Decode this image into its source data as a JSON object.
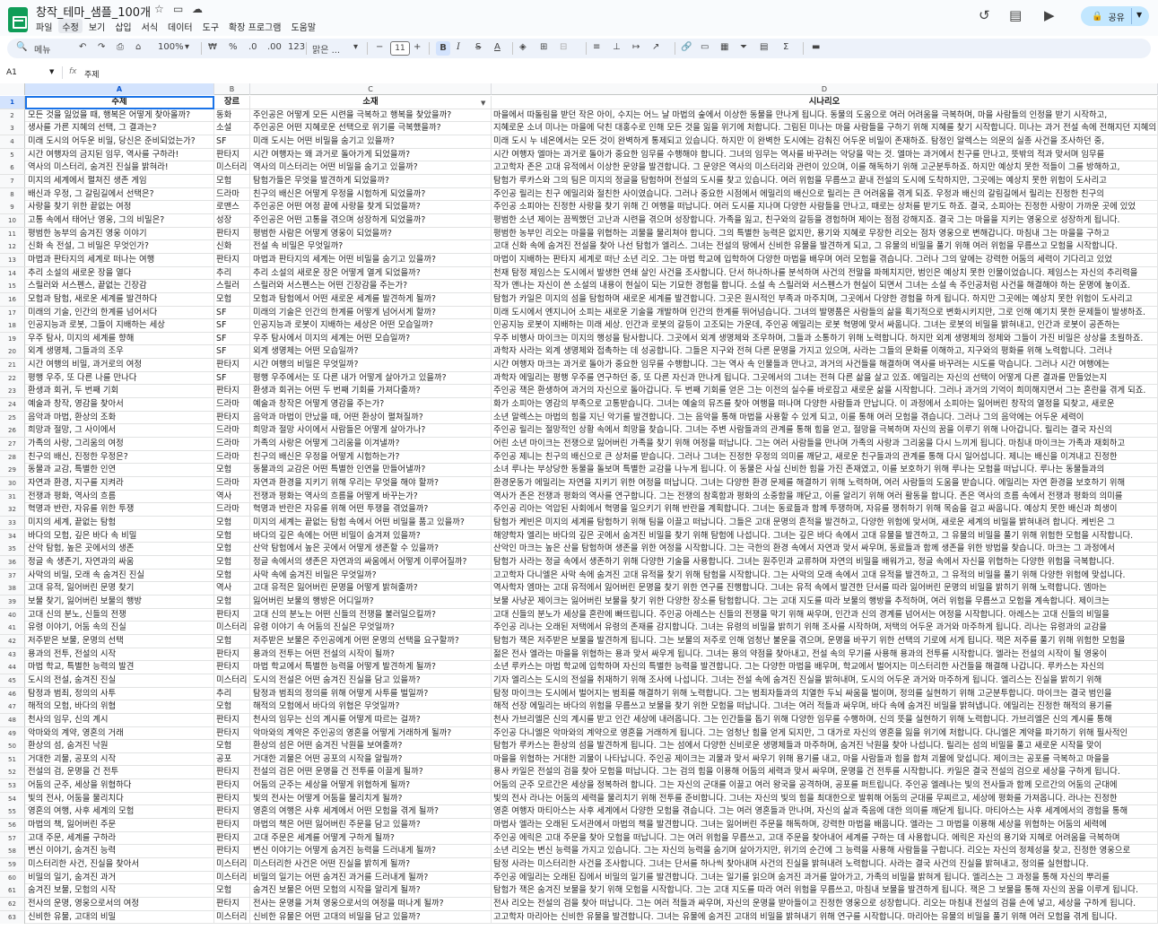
{
  "app": {
    "doc_title": "창작_테마_샘플_100개",
    "menus": [
      "파일",
      "수정",
      "보기",
      "삽입",
      "서식",
      "데이터",
      "도구",
      "확장 프로그램",
      "도움말"
    ],
    "active_menu": "수정",
    "share_label": "공유"
  },
  "toolbar": {
    "search_label": "메뉴",
    "zoom": "100%",
    "currency": "₩",
    "percent": "%",
    "dec_minus": ".0",
    "dec_plus": ".00",
    "num_format": "123",
    "font_name": "맑은 ...",
    "font_size": "11",
    "bold": "B",
    "italic": "I"
  },
  "formula_bar": {
    "cell_ref": "A1",
    "fx": "fx",
    "value": "주제"
  },
  "columns": [
    "A",
    "B",
    "C",
    "D"
  ],
  "header_row": {
    "a": "주제",
    "b": "장르",
    "c": "소재",
    "d": "시나리오"
  },
  "rows": [
    {
      "n": "2",
      "a": "모든 것을 잃었을 때, 행복은 어떻게 찾아올까?",
      "b": "동화",
      "c": "주인공은 어떻게 모든 시련을 극복하고 행복을 찾았을까?",
      "d": "마을에서 따돌림을 받던 작은 아이, 수지는 어느 날 마법의 숲에서 이상한 동물을 만나게 됩니다. 동물의 도움으로 여러 어려움을 극복하며, 마을 사람들의 인정을 받기 시작하고,"
    },
    {
      "n": "3",
      "a": "생사를 가른 지혜의 선택, 그 결과는?",
      "b": "소설",
      "c": "주인공은 어떤 지혜로운 선택으로 위기를 극복했을까?",
      "d": "지혜로운 소녀 미나는 마을에 닥친 대홍수로 인해 모든 것을 잃을 위기에 처합니다. 그림된 미나는 마을 사람들을 구하기 위해 지혜를 찾기 시작합니다. 미나는 과거 전설 속에 전해지던 지혜의 열쇠를"
    },
    {
      "n": "4",
      "a": "미래 도시의 어두운 비밀, 당신은 준비되었는가?",
      "b": "SF",
      "c": "미래 도시는 어떤 비밀을 숨기고 있을까?",
      "d": "미래 도시 누 네온에서는 모든 것이 완벽하게 통제되고 있습니다. 하지만 이 완벽한 도시에는 감춰진 어두운 비밀이 존재하죠. 탐정인 알렉스는 의문의 실종 사건을 조사하던 중,"
    },
    {
      "n": "5",
      "a": "시간 여행자의 금지된 임무, 역사를 구하라!",
      "b": "판타지",
      "c": "시간 여행자는 왜 과거로 돌아가게 되었을까?",
      "d": "시간 여행자 엘마는 과거로 돌아가 중요한 임무를 수행해야 합니다. 그녀의 임무는 역사를 바꾸려는 악당을 막는 것. 엘마는 과거에서 친구를 만나고, 뜻밖의 적과 맞서며 임무를"
    },
    {
      "n": "6",
      "a": "역사의 미스터리, 숨겨진 진실을 밝혀라!",
      "b": "미스터리",
      "c": "역사의 미스터리는 어떤 비밀을 숨기고 있을까?",
      "d": "고고학자 존은 고대 유적에서 이상한 문양을 발견합니다. 그 문양은 역사의 미스터리와 관련이 있으며, 이를 해독하기 위해 고군분투하죠. 하지만 예상치 못한 적들이 그를 방해하고,"
    },
    {
      "n": "7",
      "a": "미지의 세계에서 펼쳐진 생존 게임",
      "b": "모험",
      "c": "탐험가들은 무엇을 발견하게 되었을까?",
      "d": "탐험가 루카스와 그의 팀은 미지의 정글을 탐험하며 전설의 도시를 찾고 있습니다. 여러 위험을 무릅쓰고 끝내 전설의 도시에 도착하지만, 그곳에는 예상치 못한 위험이 도사리고"
    },
    {
      "n": "8",
      "a": "배신과 우정, 그 갈림길에서 선택은?",
      "b": "드라마",
      "c": "친구의 배신은 어떻게 우정을 시험하게 되었을까?",
      "d": "주인공 릴리는 친구 에밀리와 절친한 사이였습니다. 그러나 중요한 시점에서 에밀리의 배신으로 릴리는 큰 어려움을 겪게 되죠. 우정과 배신의 갈림길에서 릴리는 진정한 친구의"
    },
    {
      "n": "9",
      "a": "사랑을 찾기 위한 끝없는 여정",
      "b": "로맨스",
      "c": "주인공은 어떤 여정 끝에 사랑을 찾게 되었을까?",
      "d": "주인공 소피아는 진정한 사랑을 찾기 위해 긴 여행을 떠납니다. 여러 도시를 지나며 다양한 사람들을 만나고, 때로는 상처를 받기도 하죠. 결국, 소피아는 진정한 사랑이 가까운 곳에 있었"
    },
    {
      "n": "10",
      "a": "고통 속에서 태어난 영웅, 그의 비밀은?",
      "b": "성장",
      "c": "주인공은 어떤 고통을 겪으며 성장하게 되었을까?",
      "d": "평범한 소년 제이는 끔찍했던 고난과 시련을 겪으며 성장합니다. 가족을 잃고, 친구와의 갈등을 경험하며 제이는 점점 강해지죠. 결국 그는 마을을 지키는 영웅으로 성장하게 됩니다."
    },
    {
      "n": "11",
      "a": "평범한 농부의 숨겨진 영웅 이야기",
      "b": "판타지",
      "c": "평범한 사람은 어떻게 영웅이 되었을까?",
      "d": "평범한 농부인 리오는 마을을 위협하는 괴물을 물리쳐야 합니다. 그의 특별한 능력은 없지만, 용기와 지혜로 무장한 리오는 점차 영웅으로 변해갑니다. 마침내 그는 마을을 구하고"
    },
    {
      "n": "12",
      "a": "신화 속 전설, 그 비밀은 무엇인가?",
      "b": "신화",
      "c": "전설 속 비밀은 무엇일까?",
      "d": "고대 신화 속에 숨겨진 전설을 찾아 나선 탐험가 엘리스. 그녀는 전설의 땅에서 신비한 유물을 발견하게 되고, 그 유물의 비밀을 풀기 위해 여러 위험을 무릅쓰고 모험을 시작합니다."
    },
    {
      "n": "13",
      "a": "마법과 판타지의 세계로 떠나는 여행",
      "b": "판타지",
      "c": "마법과 판타지의 세계는 어떤 비밀을 숨기고 있을까?",
      "d": "마법이 지배하는 판타지 세계로 떠난 소년 리오. 그는 마법 학교에 입학하여 다양한 마법을 배우며 여러 모험을 겪습니다. 그러나 그의 앞에는 강력한 어둠의 세력이 기다리고 있었"
    },
    {
      "n": "14",
      "a": "추리 소설의 새로운 장을 열다",
      "b": "추리",
      "c": "추리 소설의 새로운 장은 어떻게 열게 되었을까?",
      "d": "천재 탐정 제임스는 도시에서 발생한 연쇄 살인 사건을 조사합니다. 단서 하나하나를 분석하며 사건의 전말을 파헤치지만, 범인은 예상치 못한 인물이었습니다. 제임스는 자신의 추리력을"
    },
    {
      "n": "15",
      "a": "스릴러와 서스펜스, 끝없는 긴장감",
      "b": "스릴러",
      "c": "스릴러와 서스펜스는 어떤 긴장감을 주는가?",
      "d": "작가 앤나는 자신이 쓴 소설의 내용이 현실이 되는 기묘한 경험을 합니다. 소설 속 스릴러와 서스펜스가 현실이 되면서 그녀는 소설 속 주인공처럼 사건을 해결해야 하는 운명에 놓이죠."
    },
    {
      "n": "16",
      "a": "모험과 탐험, 새로운 세계를 발견하다",
      "b": "모험",
      "c": "모험과 탐험에서 어떤 새로운 세계를 발견하게 될까?",
      "d": "탐험가 카일은 미지의 섬을 탐험하며 새로운 세계를 발견합니다. 그곳은 원시적인 부족과 마주치며, 그곳에서 다양한 경험을 하게 됩니다. 하지만 그곳에는 예상치 못한 위험이 도사리고"
    },
    {
      "n": "17",
      "a": "미래의 기술, 인간의 한계를 넘어서다",
      "b": "SF",
      "c": "미래의 기술은 인간의 한계를 어떻게 넘어서게 할까?",
      "d": "미래 도시에서 엔지니어 소피는 새로운 기술을 개발하며 인간의 한계를 뛰어넘습니다. 그녀의 발명품은 사람들의 삶을 획기적으로 변화시키지만, 그로 인해 예기치 못한 문제들이 발생하죠."
    },
    {
      "n": "18",
      "a": "인공지능과 로봇, 그들이 지배하는 세상",
      "b": "SF",
      "c": "인공지능과 로봇이 지배하는 세상은 어떤 모습일까?",
      "d": "인공지능 로봇이 지배하는 미래 세상. 인간과 로봇의 갈등이 고조되는 가운데, 주인공 에밀리는 로봇 혁명에 맞서 싸웁니다. 그녀는 로봇의 비밀을 밝혀내고, 인간과 로봇이 공존하는"
    },
    {
      "n": "19",
      "a": "우주 탐사, 미지의 세계를 향해",
      "b": "SF",
      "c": "우주 탐사에서 미지의 세계는 어떤 모습일까?",
      "d": "우주 비행사 마이크는 미지의 행성을 탐사합니다. 그곳에서 외계 생명체와 조우하며, 그들과 소통하기 위해 노력합니다. 하지만 외계 생명체의 정체와 그들이 가진 비밀은 상상을 초월하죠."
    },
    {
      "n": "20",
      "a": "외계 생명체, 그들과의 조우",
      "b": "SF",
      "c": "외계 생명체는 어떤 모습일까?",
      "d": "과학자 사라는 외계 생명체와 접촉하는 데 성공합니다. 그들은 지구와 전혀 다른 문명을 가지고 있으며, 사라는 그들의 문화를 이해하고, 지구와의 평화를 위해 노력합니다. 그러나"
    },
    {
      "n": "21",
      "a": "시간 여행의 비밀, 과거로의 여정",
      "b": "판타지",
      "c": "시간 여행의 비밀은 무엇일까?",
      "d": "시간 여행자 마크는 과거로 돌아가 중요한 임무를 수행합니다. 그는 역사 속 인물들과 만나고, 과거의 사건들을 해결하며 역사를 바꾸려는 시도를 막습니다. 그러나 시간 여행에는"
    },
    {
      "n": "22",
      "a": "평행 우주, 또 다른 나를 만나다",
      "b": "SF",
      "c": "평행 우주에서는 또 다른 내가 어떻게 살아가고 있을까?",
      "d": "과학자 에밀리는 평행 우주를 연구하던 중, 또 다른 자신과 만나게 됩니다. 그곳에서의 그녀는 전혀 다른 삶을 살고 있죠. 에밀리는 자신의 선택이 어떻게 다른 결과를 만들었는지"
    },
    {
      "n": "23",
      "a": "환생과 회귀, 두 번째 기회",
      "b": "판타지",
      "c": "환생과 회귀는 어떤 두 번째 기회를 가져다줄까?",
      "d": "주인공 잭은 환생하여 과거의 자신으로 돌아갑니다. 두 번째 기회를 얻은 그는 이전의 실수를 바로잡고 새로운 삶을 시작합니다. 그러나 과거의 기억이 희미해지면서 그는 혼란을 겪게 되죠."
    },
    {
      "n": "24",
      "a": "예술과 창작, 영감을 찾아서",
      "b": "드라마",
      "c": "예술과 창작은 어떻게 영감을 주는가?",
      "d": "화가 소피아는 영감의 부족으로 고통받습니다. 그녀는 예술의 뮤즈를 찾아 여행을 떠나며 다양한 사람들과 만납니다. 이 과정에서 소피아는 잃어버린 창작의 열정을 되찾고, 새로운"
    },
    {
      "n": "25",
      "a": "음악과 마법, 환상의 조화",
      "b": "판타지",
      "c": "음악과 마법이 만났을 때, 어떤 환상이 펼쳐질까?",
      "d": "소년 알렉스는 마법의 힘을 지닌 악기를 발견합니다. 그는 음악을 통해 마법을 사용할 수 있게 되고, 이를 통해 여러 모험을 겪습니다. 그러나 그의 음악에는 어두운 세력이"
    },
    {
      "n": "26",
      "a": "희망과 절망, 그 사이에서",
      "b": "드라마",
      "c": "희망과 절망 사이에서 사람들은 어떻게 살아가나?",
      "d": "주인공 릴리는 절망적인 상황 속에서 희망을 찾습니다. 그녀는 주변 사람들과의 관계를 통해 힘을 얻고, 절망을 극복하며 자신의 꿈을 이루기 위해 나아갑니다. 릴리는 결국 자신의"
    },
    {
      "n": "27",
      "a": "가족의 사랑, 그리움의 여정",
      "b": "드라마",
      "c": "가족의 사랑은 어떻게 그리움을 이겨낼까?",
      "d": "어린 소년 마이크는 전쟁으로 잃어버린 가족을 찾기 위해 여정을 떠납니다. 그는 여러 사람들을 만나며 가족의 사랑과 그리움을 다시 느끼게 됩니다. 마침내 마이크는 가족과 재회하고"
    },
    {
      "n": "28",
      "a": "친구의 배신, 진정한 우정은?",
      "b": "드라마",
      "c": "친구의 배신은 우정을 어떻게 시험하는가?",
      "d": "주인공 제니는 친구의 배신으로 큰 상처를 받습니다. 그러나 그녀는 진정한 우정의 의미를 깨닫고, 새로운 친구들과의 관계를 통해 다시 일어섭니다. 제니는 배신을 이겨내고 진정한"
    },
    {
      "n": "29",
      "a": "동물과 교감, 특별한 인연",
      "b": "모험",
      "c": "동물과의 교감은 어떤 특별한 인연을 만들어낼까?",
      "d": "소녀 루나는 부상당한 동물을 돌보며 특별한 교감을 나누게 됩니다. 이 동물은 사실 신비한 힘을 가진 존재였고, 이를 보호하기 위해 루나는 모험을 떠납니다. 루나는 동물들과의"
    },
    {
      "n": "30",
      "a": "자연과 환경, 지구를 지켜라",
      "b": "드라마",
      "c": "자연과 환경을 지키기 위해 우리는 무엇을 해야 할까?",
      "d": "환경운동가 에밀리는 자연을 지키기 위한 여정을 떠납니다. 그녀는 다양한 환경 문제를 해결하기 위해 노력하며, 여러 사람들의 도움을 받습니다. 에밀리는 자연 환경을 보호하기 위해"
    },
    {
      "n": "31",
      "a": "전쟁과 평화, 역사의 흐름",
      "b": "역사",
      "c": "전쟁과 평화는 역사의 흐름을 어떻게 바꾸는가?",
      "d": "역사가 존은 전쟁과 평화의 역사를 연구합니다. 그는 전쟁의 참혹함과 평화의 소중함을 깨닫고, 이를 알리기 위해 여러 활동을 합니다. 존은 역사의 흐름 속에서 전쟁과 평화의 의미를"
    },
    {
      "n": "32",
      "a": "혁명과 반란, 자유를 위한 투쟁",
      "b": "드라마",
      "c": "혁명과 반란은 자유를 위해 어떤 투쟁을 겪었을까?",
      "d": "주인공 리아는 억압된 사회에서 혁명을 일으키기 위해 반란을 계획합니다. 그녀는 동료들과 함께 투쟁하며, 자유를 쟁취하기 위해 목숨을 걸고 싸웁니다. 예상치 못한 배신과 희생이"
    },
    {
      "n": "33",
      "a": "미지의 세계, 끝없는 탐험",
      "b": "모험",
      "c": "미지의 세계는 끝없는 탐험 속에서 어떤 비밀을 품고 있을까?",
      "d": "탐험가 케빈은 미지의 세계를 탐험하기 위해 팀을 이끌고 떠납니다. 그들은 고대 문명의 흔적을 발견하고, 다양한 위험에 맞서며, 새로운 세계의 비밀을 밝혀내려 합니다. 케빈은 그"
    },
    {
      "n": "34",
      "a": "바다의 모험, 깊은 바다 속 비밀",
      "b": "모험",
      "c": "바다의 깊은 속에는 어떤 비밀이 숨겨져 있을까?",
      "d": "해양학자 엘리는 바다의 깊은 곳에서 숨겨진 비밀을 찾기 위해 탐험에 나섭니다. 그녀는 깊은 바다 속에서 고대 유물을 발견하고, 그 유물의 비밀을 풀기 위해 위험한 모험을 시작합니다."
    },
    {
      "n": "35",
      "a": "산악 탐험, 높은 곳에서의 생존",
      "b": "모험",
      "c": "산악 탐험에서 높은 곳에서 어떻게 생존할 수 있을까?",
      "d": "산악인 마크는 높은 산을 탐험하며 생존을 위한 여정을 시작합니다. 그는 극한의 환경 속에서 자연과 맞서 싸우며, 동료들과 함께 생존을 위한 방법을 찾습니다. 마크는 그 과정에서"
    },
    {
      "n": "36",
      "a": "정글 속 생존기, 자연과의 싸움",
      "b": "모험",
      "c": "정글 속에서의 생존은 자연과의 싸움에서 어떻게 이루어질까?",
      "d": "탐험가 사라는 정글 속에서 생존하기 위해 다양한 기술을 사용합니다. 그녀는 원주민과 교류하며 자연의 비밀을 배워가고, 정글 속에서 자신을 위협하는 다양한 위험을 극복합니다."
    },
    {
      "n": "37",
      "a": "사막의 비밀, 모래 속 숨겨진 진실",
      "b": "모험",
      "c": "사막 속에 숨겨진 비밀은 무엇일까?",
      "d": "고고학자 다니엘은 사막 속에 숨겨진 고대 유적을 찾기 위해 탐험을 시작합니다. 그는 사막의 모래 속에서 고대 유적을 발견하고, 그 유적의 비밀을 풀기 위해 다양한 위험에 맞섭니다."
    },
    {
      "n": "38",
      "a": "고대 유적, 잃어버린 문명 찾기",
      "b": "역사",
      "c": "고대 유적은 잃어버린 문명을 어떻게 밝혀줄까?",
      "d": "역사학자 엠마는 고대 유적에서 잃어버린 문명을 찾기 위한 연구를 진행합니다. 그녀는 유적 속에서 발견한 단서를 따라 잃어버린 문명의 비밀을 밝히기 위해 노력합니다. 엠마는"
    },
    {
      "n": "39",
      "a": "보물 찾기, 잃어버린 보물의 행방",
      "b": "모험",
      "c": "잃어버린 보물의 행방은 어디일까?",
      "d": "보물 사냥꾼 제이크는 잃어버린 보물을 찾기 위한 다양한 장소를 탐험합니다. 그는 고대 지도를 따라 보물의 행방을 추적하며, 여러 위험을 무릅쓰고 모험을 계속합니다. 제이크는"
    },
    {
      "n": "40",
      "a": "고대 신의 분노, 신들의 전쟁",
      "b": "판타지",
      "c": "고대 신의 분노는 어떤 신들의 전쟁을 불러일으킬까?",
      "d": "고대 신들의 분노가 세상을 혼란에 빠뜨립니다. 주인공 아레스는 신들의 전쟁을 막기 위해 싸우며, 인간과 신의 경계를 넘어서는 여정을 시작합니다. 아레스는 고대 신들의 비밀을"
    },
    {
      "n": "41",
      "a": "유령 이야기, 어둠 속의 진실",
      "b": "미스터리",
      "c": "유령 이야기 속 어둠의 진실은 무엇일까?",
      "d": "주인공 리나는 오래된 저택에서 유령의 존재를 감지합니다. 그녀는 유령의 비밀을 밝히기 위해 조사를 시작하며, 저택의 어두운 과거와 마주하게 됩니다. 리나는 유령과의 교감을"
    },
    {
      "n": "42",
      "a": "저주받은 보물, 운명의 선택",
      "b": "모험",
      "c": "저주받은 보물은 주인공에게 어떤 운명의 선택을 요구할까?",
      "d": "탐험가 잭은 저주받은 보물을 발견하게 됩니다. 그는 보물의 저주로 인해 엄청난 불운을 겪으며, 운명을 바꾸기 위한 선택의 기로에 서게 됩니다. 잭은 저주를 풀기 위해 위험한 모험을"
    },
    {
      "n": "43",
      "a": "용과의 전투, 전설의 시작",
      "b": "판타지",
      "c": "용과의 전투는 어떤 전설의 시작이 될까?",
      "d": "젊은 전사 엘라는 마을을 위협하는 용과 맞서 싸우게 됩니다. 그녀는 용의 약점을 찾아내고, 전설 속의 무기를 사용해 용과의 전투를 시작합니다. 엘라는 전설의 시작이 될 영웅이"
    },
    {
      "n": "44",
      "a": "마법 학교, 특별한 능력의 발견",
      "b": "판타지",
      "c": "마법 학교에서 특별한 능력을 어떻게 발견하게 될까?",
      "d": "소년 루카스는 마법 학교에 입학하며 자신의 특별한 능력을 발견합니다. 그는 다양한 마법을 배우며, 학교에서 벌어지는 미스터리한 사건들을 해결해 나갑니다. 루카스는 자신의"
    },
    {
      "n": "45",
      "a": "도시의 전설, 숨겨진 진실",
      "b": "미스터리",
      "c": "도시의 전설은 어떤 숨겨진 진실을 담고 있을까?",
      "d": "기자 엘리스는 도시의 전설을 취재하기 위해 조사에 나섭니다. 그녀는 전설 속에 숨겨진 진실을 밝혀내며, 도시의 어두운 과거와 마주하게 됩니다. 엘리스는 진실을 밝히기 위해"
    },
    {
      "n": "46",
      "a": "탐정과 범죄, 정의의 사투",
      "b": "추리",
      "c": "탐정과 범죄의 정의를 위해 어떻게 사투를 벌일까?",
      "d": "탐정 마이크는 도시에서 벌어지는 범죄를 해결하기 위해 노력합니다. 그는 범죄자들과의 치열한 두뇌 싸움을 벌이며, 정의를 실현하기 위해 고군분투합니다. 마이크는 결국 범인을"
    },
    {
      "n": "47",
      "a": "해적의 모험, 바다의 위협",
      "b": "모험",
      "c": "해적의 모험에서 바다의 위협은 무엇일까?",
      "d": "해적 선장 에밀리는 바다의 위험을 무릅쓰고 보물을 찾기 위한 모험을 떠납니다. 그녀는 여러 적들과 싸우며, 바다 속에 숨겨진 비밀을 밝혀냅니다. 에밀리는 진정한 해적의 용기를"
    },
    {
      "n": "48",
      "a": "천사의 임무, 신의 계시",
      "b": "판타지",
      "c": "천사의 임무는 신의 계시를 어떻게 따르는 걸까?",
      "d": "천사 가브리엘은 신의 계시를 받고 인간 세상에 내려옵니다. 그는 인간들을 돕기 위해 다양한 임무를 수행하며, 신의 뜻을 실현하기 위해 노력합니다. 가브리엘은 신의 계시를 통해"
    },
    {
      "n": "49",
      "a": "악마와의 계약, 영혼의 거래",
      "b": "판타지",
      "c": "악마와의 계약은 주인공의 영혼을 어떻게 거래하게 될까?",
      "d": "주인공 다니엘은 악마와의 계약으로 영혼을 거래하게 됩니다. 그는 엄청난 힘을 얻게 되지만, 그 대가로 자신의 영혼을 잃을 위기에 처합니다. 다니엘은 계약을 파기하기 위해 필사적인"
    },
    {
      "n": "50",
      "a": "환상의 섬, 숨겨진 낙원",
      "b": "모험",
      "c": "환상의 섬은 어떤 숨겨진 낙원을 보여줄까?",
      "d": "탐험가 루카스는 환상의 섬을 발견하게 됩니다. 그는 섬에서 다양한 신비로운 생명체들과 마주하며, 숨겨진 낙원을 찾아 나섭니다. 릴리는 섬의 비밀을 풀고 새로운 시작을 맞이"
    },
    {
      "n": "51",
      "a": "거대한 괴물, 공포의 시작",
      "b": "공포",
      "c": "거대한 괴물은 어떤 공포의 시작을 알릴까?",
      "d": "마을을 위협하는 거대한 괴물이 나타납니다. 주인공 제이크는 괴물과 맞서 싸우기 위해 용기를 내고, 마을 사람들과 힘을 합쳐 괴물에 맞섭니다. 제이크는 공포를 극복하고 마을을"
    },
    {
      "n": "52",
      "a": "전설의 검, 운명을 건 전투",
      "b": "판타지",
      "c": "전설의 검은 어떤 운명을 건 전투를 이끌게 될까?",
      "d": "용사 카일은 전설의 검을 찾아 모험을 떠납니다. 그는 검의 힘을 이용해 어둠의 세력과 맞서 싸우며, 운명을 건 전투를 시작합니다. 카일은 결국 전설의 검으로 세상을 구하게 됩니다."
    },
    {
      "n": "53",
      "a": "어둠의 군주, 세상을 위협하다",
      "b": "판타지",
      "c": "어둠의 군주는 세상을 어떻게 위협하게 될까?",
      "d": "어둠의 군주 모르간은 세상을 정복하려 합니다. 그는 자신의 군대를 이끌고 여러 왕국을 공격하며, 공포를 퍼트립니다. 주인공 엘레나는 빛의 전사들과 함께 모르간의 어둠의 군대에"
    },
    {
      "n": "54",
      "a": "빛의 전사, 어둠을 물리치다",
      "b": "판타지",
      "c": "빛의 전사는 어떻게 어둠을 물리치게 될까?",
      "d": "빛의 전사 라나는 어둠의 세력을 물리치기 위해 전투를 준비합니다. 그녀는 자신의 빛의 힘을 최대한으로 발휘해 어둠의 군대를 무찌르고, 세상에 평화를 가져옵니다. 라나는 진정한"
    },
    {
      "n": "55",
      "a": "영혼의 여행, 사후 세계의 모험",
      "b": "판타지",
      "c": "영혼의 여행은 사후 세계에서 어떤 모험을 겪게 될까?",
      "d": "영혼 여행자 마티아스는 사후 세계에서 다양한 모험을 겪습니다. 그는 여러 영혼들과 만나며, 자신의 삶과 죽음에 대한 의미를 깨닫게 됩니다. 마티아스는 사후 세계에서의 경험을 통해"
    },
    {
      "n": "56",
      "a": "마법의 책, 잃어버린 주문",
      "b": "판타지",
      "c": "마법의 책은 어떤 잃어버린 주문을 담고 있을까?",
      "d": "마법사 엘라는 오래된 도서관에서 마법의 책을 발견합니다. 그녀는 잃어버린 주문을 해독하며, 강력한 마법을 배웁니다. 엘라는 그 마법을 이용해 세상을 위협하는 어둠의 세력에"
    },
    {
      "n": "57",
      "a": "고대 주문, 세계를 구하라",
      "b": "판타지",
      "c": "고대 주문은 세계를 어떻게 구하게 될까?",
      "d": "주인공 에릭은 고대 주문을 찾아 모험을 떠납니다. 그는 여러 위험을 무릅쓰고, 고대 주문을 찾아내어 세계를 구하는 데 사용합니다. 에릭은 자신의 용기와 지혜로 어려움을 극복하며"
    },
    {
      "n": "58",
      "a": "변신 이야기, 숨겨진 능력",
      "b": "판타지",
      "c": "변신 이야기는 어떻게 숨겨진 능력을 드러내게 될까?",
      "d": "소년 리오는 변신 능력을 가지고 있습니다. 그는 자신의 능력을 숨기며 살아가지만, 위기의 순간에 그 능력을 사용해 사람들을 구합니다. 리오는 자신의 정체성을 찾고, 진정한 영웅으로"
    },
    {
      "n": "59",
      "a": "미스터리한 사건, 진실을 찾아서",
      "b": "미스터리",
      "c": "미스터리한 사건은 어떤 진실을 밝히게 될까?",
      "d": "탐정 사라는 미스터리한 사건을 조사합니다. 그녀는 단서를 하나씩 찾아내며 사건의 진실을 밝혀내려 노력합니다. 사라는 결국 사건의 진실을 밝혀내고, 정의를 실현합니다."
    },
    {
      "n": "60",
      "a": "비밀의 일기, 숨겨진 과거",
      "b": "미스터리",
      "c": "비밀의 일기는 어떤 숨겨진 과거를 드러내게 될까?",
      "d": "주인공 에밀리는 오래된 집에서 비밀의 일기를 발견합니다. 그녀는 일기를 읽으며 숨겨진 과거를 알아가고, 가족의 비밀을 밝혀게 됩니다. 엘리스는 그 과정을 통해 자신의 뿌리를"
    },
    {
      "n": "61",
      "a": "숨겨진 보물, 모험의 시작",
      "b": "모험",
      "c": "숨겨진 보물은 어떤 모험의 시작을 알리게 될까?",
      "d": "탐험가 잭은 숨겨진 보물을 찾기 위해 모험을 시작합니다. 그는 고대 지도를 따라 여러 위험을 무릅쓰고, 마침내 보물을 발견하게 됩니다. 잭은 그 보물을 통해 자신의 꿈을 이루게 됩니다."
    },
    {
      "n": "62",
      "a": "전사의 운명, 영웅으로서의 여정",
      "b": "판타지",
      "c": "전사는 운명을 거쳐 영웅으로서의 여정을 떠나게 될까?",
      "d": "전사 리오는 전설의 검을 찾아 떠납니다. 그는 여러 적들과 싸우며, 자신의 운명을 받아들이고 진정한 영웅으로 성장합니다. 리오는 마침내 전설의 검을 손에 넣고, 세상을 구하게 됩니다."
    },
    {
      "n": "63",
      "a": "신비한 유물, 고대의 비밀",
      "b": "미스터리",
      "c": "신비한 유물은 어떤 고대의 비밀을 담고 있을까?",
      "d": "고고학자 마리아는 신비한 유물을 발견합니다. 그녀는 유물에 숨겨진 고대의 비밀을 밝혀내기 위해 연구를 시작합니다. 마리아는 유물의 비밀을 풀기 위해 여러 모험을 겪게 됩니다."
    }
  ]
}
